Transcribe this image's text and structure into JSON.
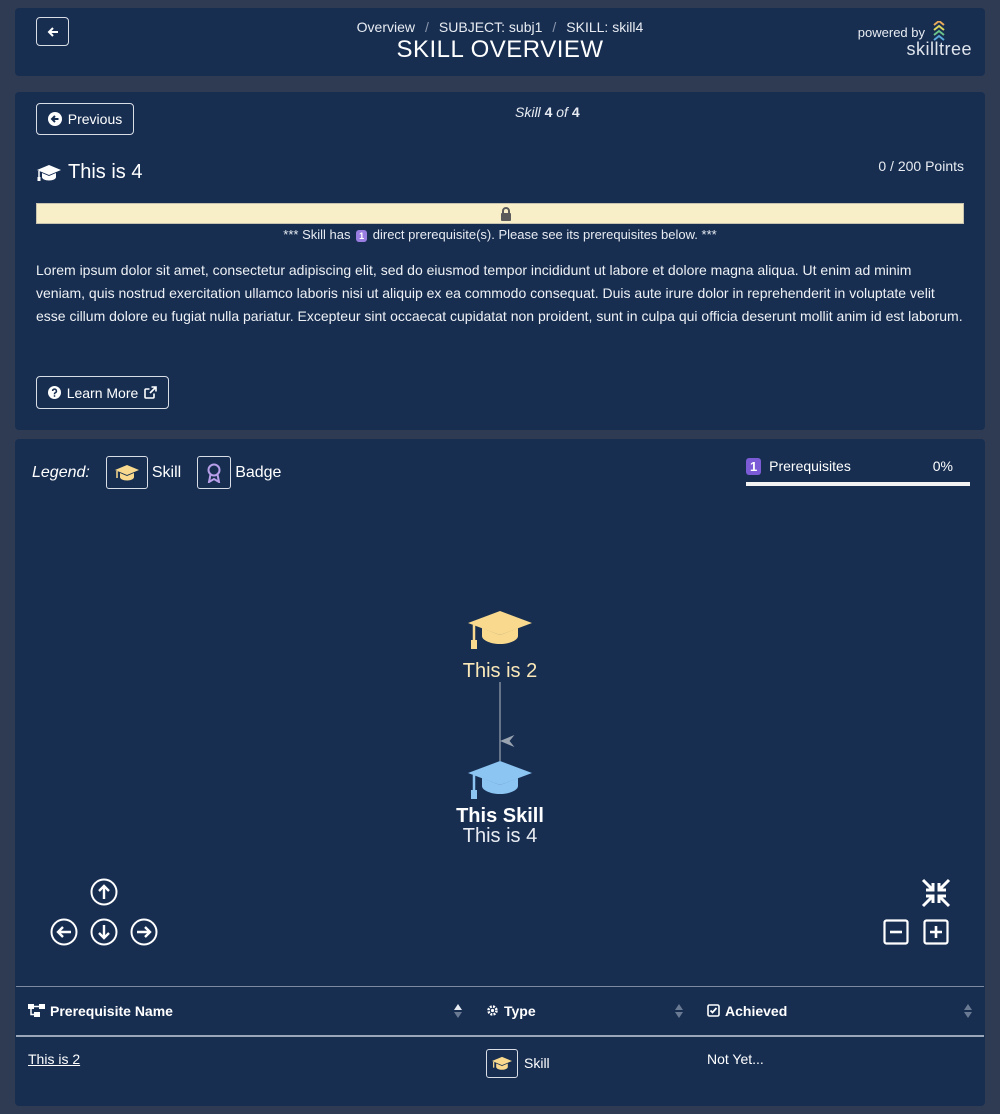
{
  "header": {
    "breadcrumb": [
      "Overview",
      "SUBJECT: subj1",
      "SKILL: skill4"
    ],
    "title": "SKILL OVERVIEW",
    "powered_by": "powered by",
    "brand": "skilltree"
  },
  "skill": {
    "previous_label": "Previous",
    "counter_prefix": "Skill",
    "counter_current": "4",
    "counter_of": "of",
    "counter_total": "4",
    "name": "This is 4",
    "points": "0 / 200 Points",
    "progress_fraction": 0,
    "prereq_note_before": "*** Skill has",
    "prereq_count": "1",
    "prereq_note_after": "direct prerequisite(s). Please see its prerequisites below. ***",
    "description": "Lorem ipsum dolor sit amet, consectetur adipiscing elit, sed do eiusmod tempor incididunt ut labore et dolore magna aliqua. Ut enim ad minim veniam, quis nostrud exercitation ullamco laboris nisi ut aliquip ex ea commodo consequat. Duis aute irure dolor in reprehenderit in voluptate velit esse cillum dolore eu fugiat nulla pariatur. Excepteur sint occaecat cupidatat non proident, sunt in culpa qui officia deserunt mollit anim id est laborum.",
    "learn_more_label": "Learn More"
  },
  "legend": {
    "label": "Legend:",
    "skill_label": "Skill",
    "badge_label": "Badge"
  },
  "dependencies": {
    "count": "1",
    "label": "Prerequisites",
    "percent": "0%",
    "progress_fraction": 0
  },
  "graph": {
    "prereq_node_label": "This is 2",
    "this_node_title": "This Skill",
    "this_node_label": "This is 4"
  },
  "table": {
    "columns": [
      "Prerequisite Name",
      "Type",
      "Achieved"
    ],
    "rows": [
      {
        "name": "This is 2",
        "type": "Skill",
        "achieved": "Not Yet..."
      }
    ]
  },
  "colors": {
    "page_bg": "#2f3b52",
    "card_bg": "#172e51",
    "skill_icon": "#f8d98d",
    "this_skill_icon": "#8cc4f2",
    "badge_purple": "#9a7de0",
    "progress_track": "#f8efc9"
  }
}
